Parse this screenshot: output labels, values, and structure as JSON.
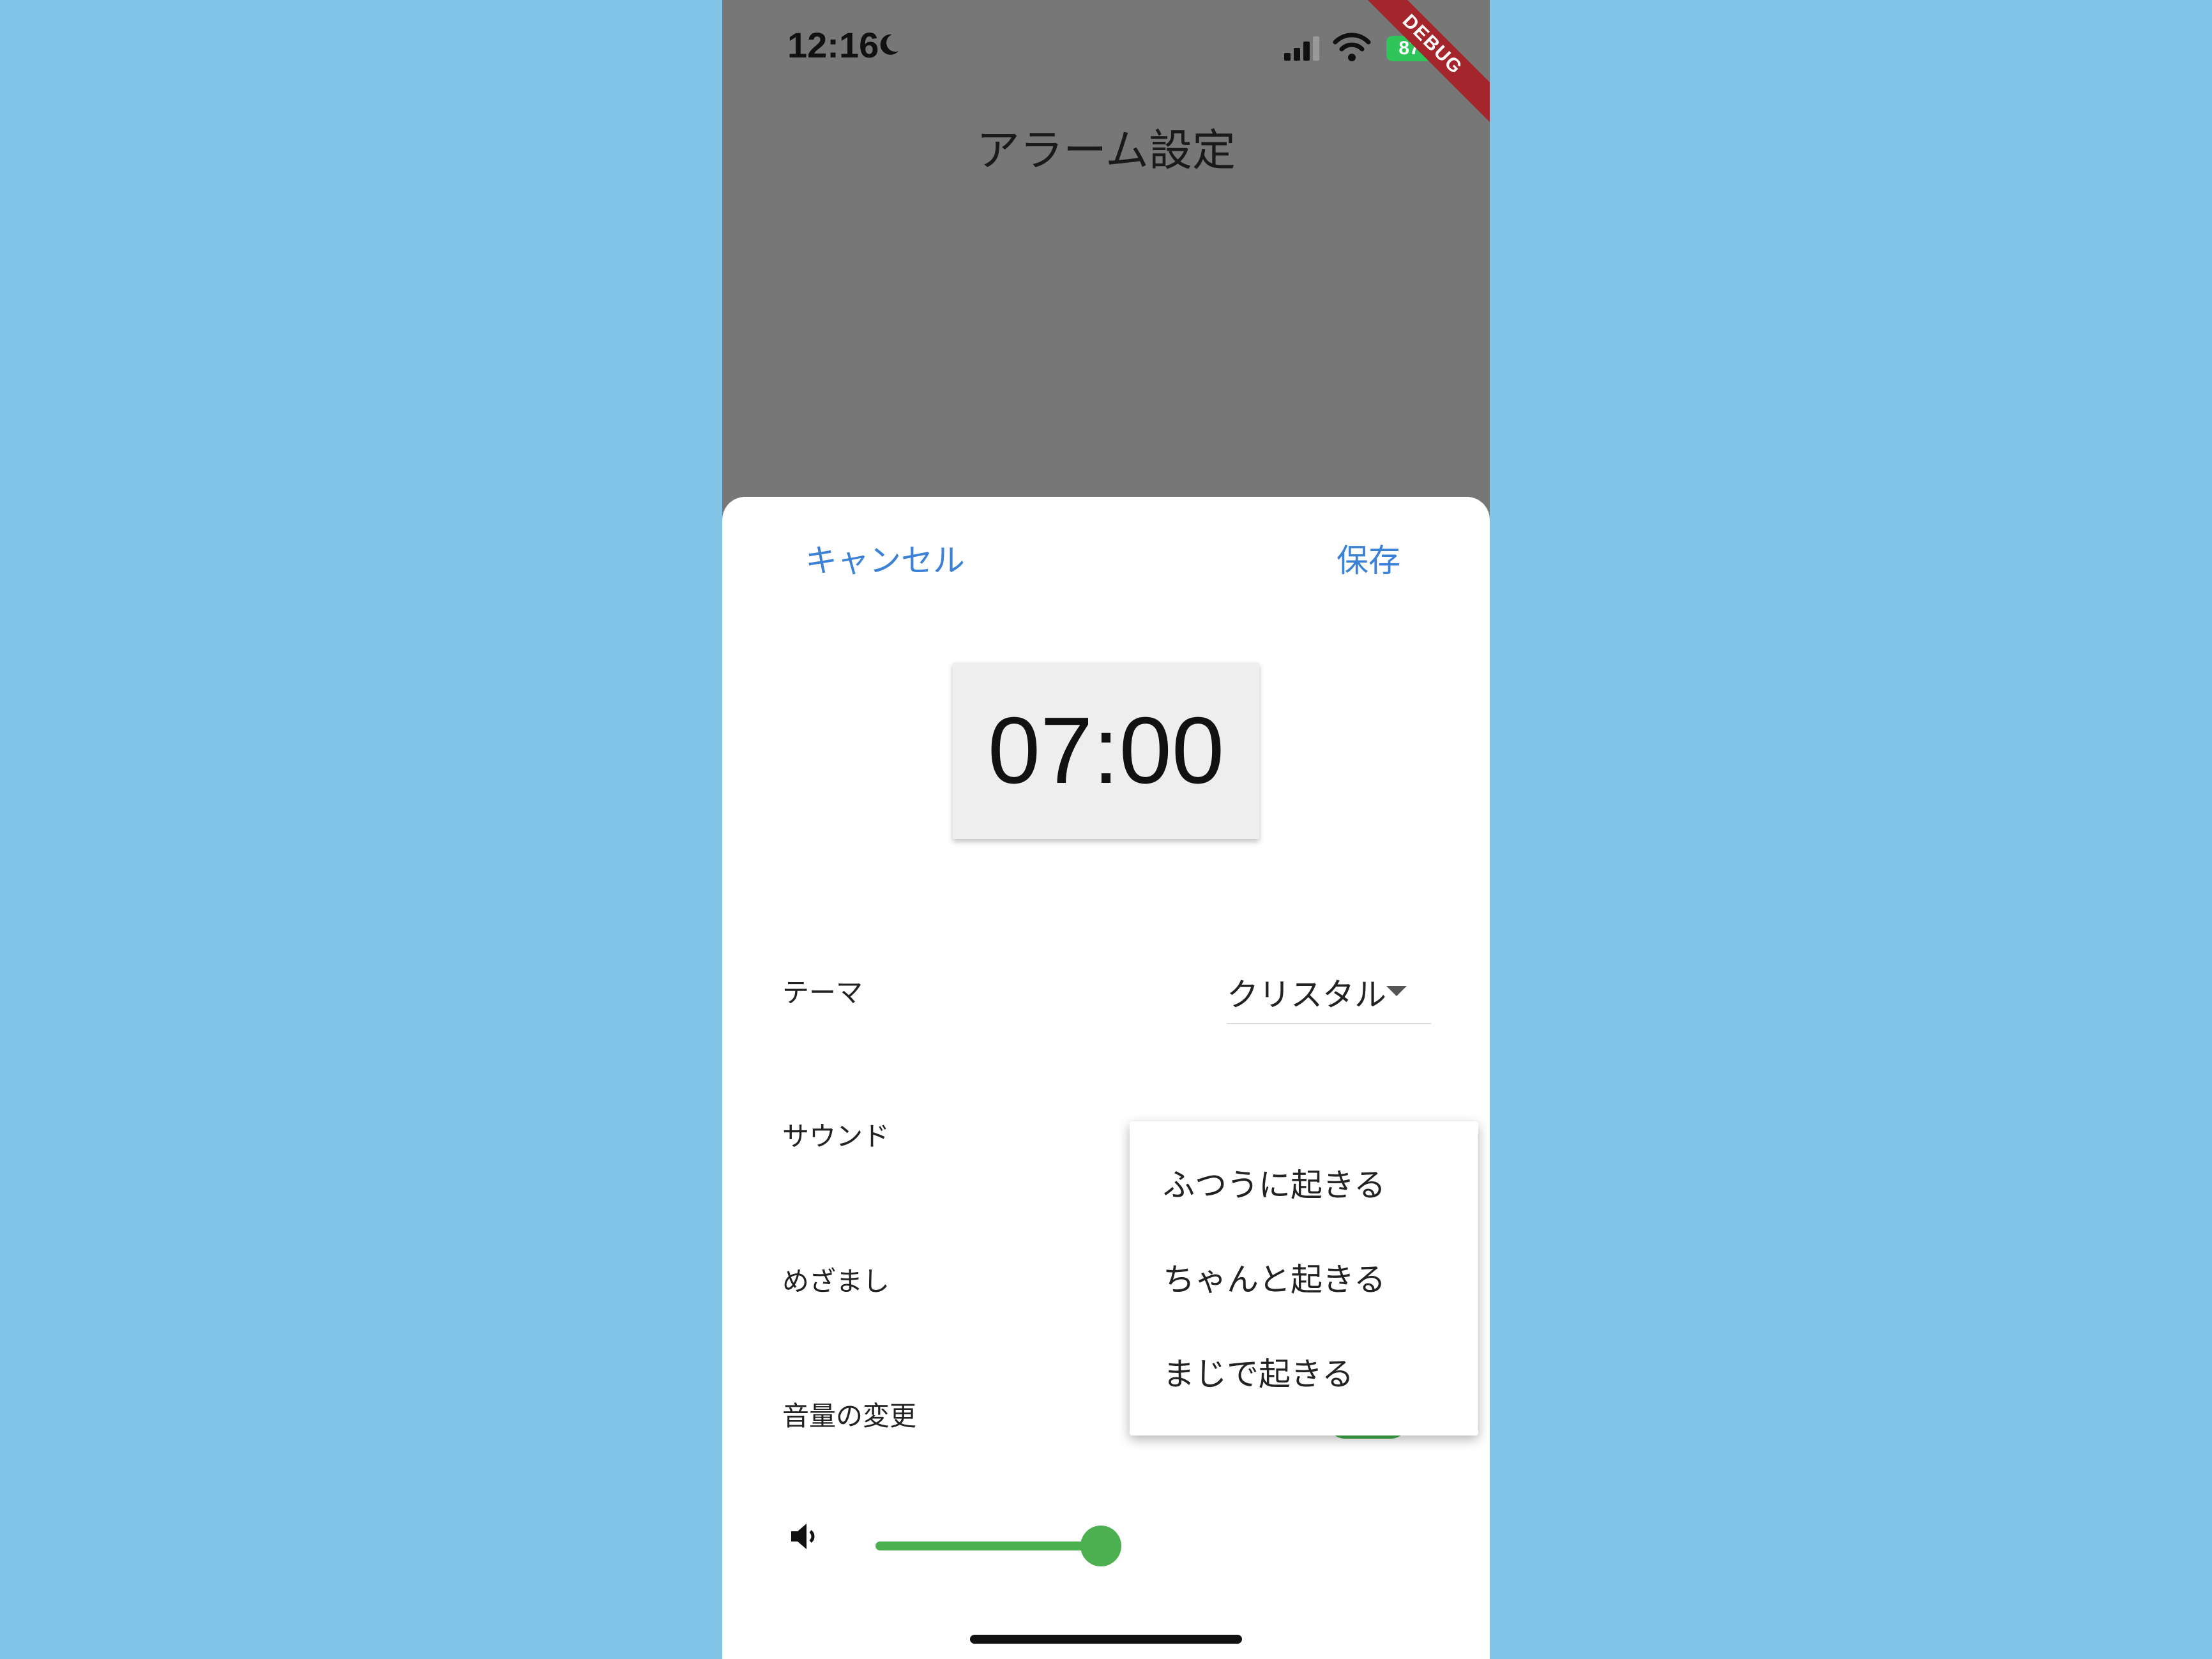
{
  "status_bar": {
    "time": "12:16",
    "battery": "87",
    "debug_label": "DEBUG"
  },
  "app": {
    "title": "アラーム設定"
  },
  "sheet": {
    "cancel_label": "キャンセル",
    "save_label": "保存",
    "alarm_time": "07:00",
    "rows": {
      "theme_label": "テーマ",
      "theme_value": "クリスタル",
      "sound_label": "サウンド",
      "wakeup_label": "めざまし",
      "volume_change_label": "音量の変更"
    },
    "volume_level_fraction": 0.6,
    "toggle_on": true,
    "accent_color": "#4caf50",
    "link_color": "#3b82d6"
  },
  "menu": {
    "items": [
      "ふつうに起きる",
      "ちゃんと起きる",
      "まじで起きる"
    ]
  }
}
